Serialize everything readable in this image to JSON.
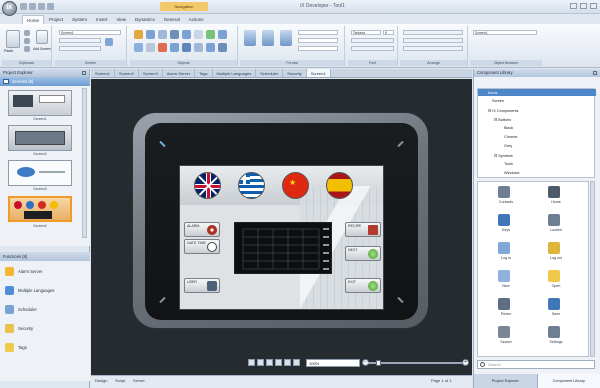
{
  "app": {
    "orb_label": "IX",
    "title": "iX Developer - Tool1",
    "context_tab": "Navigation"
  },
  "ribbon": {
    "tabs": [
      "Home",
      "Project",
      "System",
      "Insert",
      "View",
      "Dynamics",
      "General",
      "Actions"
    ],
    "active_tab": "Home",
    "groups": [
      "Clipboard",
      "Screen",
      "Objects",
      "Format",
      "Font",
      "Arrange",
      "Object Browser"
    ],
    "paste_label": "Paste",
    "add_screen_label": "Add Screen",
    "font_name": "Tahoma",
    "font_size": "8",
    "screen_name_value": "Screen1"
  },
  "left_panel": {
    "header": "Project Explorer",
    "screens_label": "Screens [6]",
    "thumbnails": [
      "Screen1",
      "Screen2",
      "Screen3",
      "Screen4"
    ],
    "project_header": "Functions [8]",
    "project_items": [
      "Alarm Server",
      "Multiple Languages",
      "Scheduler",
      "Security",
      "Tags"
    ]
  },
  "doc_tabs": [
    "Screen1",
    "Screen2",
    "Screen3",
    "Alarm Server",
    "Tags",
    "Multiple Languages",
    "Scheduler",
    "Security",
    "Screen4"
  ],
  "active_doc_tab": "Screen4",
  "hmi_screen": {
    "flags": [
      "united-kingdom-flag",
      "greece-flag",
      "china-flag",
      "spain-flag"
    ],
    "buttons_left": [
      "ALARM",
      "DATE TIME",
      "USER"
    ],
    "buttons_right": [
      "RECIPE",
      "NEXT",
      "EXIT"
    ]
  },
  "status_bar": {
    "tabs": [
      "Design",
      "Script",
      "Server"
    ],
    "zoom_value": "100%",
    "page_info": "Page 1 of 1"
  },
  "right_panel": {
    "header": "Component Library",
    "tree_root": "Icons",
    "tree_items": [
      "Screen",
      "IX Components",
      "Buttons",
      "Black",
      "Chrome",
      "Grey",
      "Symbols",
      "Tools",
      "Windows"
    ],
    "gallery_items": [
      "Contacts",
      "Home",
      "Keys",
      "Locked",
      "Log in",
      "Log out",
      "New",
      "Open",
      "Printer",
      "Save",
      "Search",
      "Settings"
    ],
    "search_placeholder": "Search",
    "bottom_tabs": [
      "Project Explorer",
      "Component Library"
    ]
  },
  "colors": {
    "accent": "#4d86c9",
    "canvas_bg": "#262b30",
    "context_tab": "#f2c86a"
  }
}
